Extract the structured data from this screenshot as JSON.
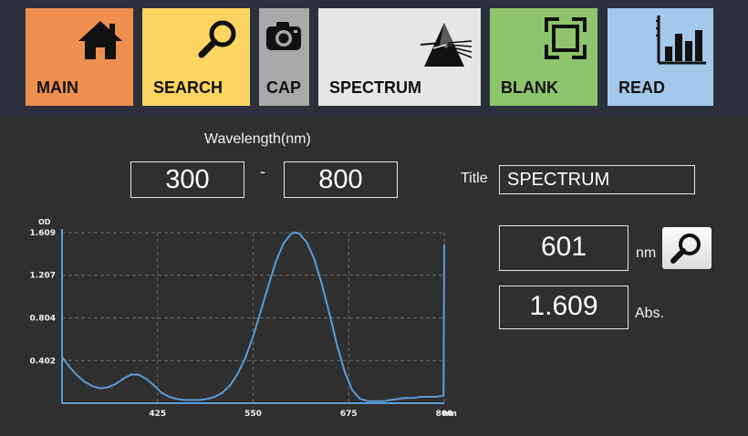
{
  "nav": {
    "main": "MAIN",
    "search": "SEARCH",
    "cap": "CAP",
    "spectrum": "SPECTRUM",
    "blank": "BLANK",
    "read": "READ"
  },
  "colors": {
    "main": "#ee8f4f",
    "search": "#fbd462",
    "cap": "#a9a9a9",
    "spectrum": "#e6e6e6",
    "blank": "#8ec46d",
    "read": "#a4c8ea",
    "curve": "#5b9bd5"
  },
  "wavelength": {
    "heading": "Wavelength(nm)",
    "start": "300",
    "separator": "-",
    "end": "800"
  },
  "title": {
    "label": "Title",
    "value": "SPECTRUM"
  },
  "readout": {
    "wavelength": "601",
    "wavelength_unit": "nm",
    "absorbance": "1.609",
    "absorbance_unit": "Abs."
  },
  "chart_data": {
    "type": "line",
    "title": "",
    "ylabel": "OD",
    "xlabel": "nm",
    "xlim": [
      300,
      800
    ],
    "ylim": [
      0,
      1.609
    ],
    "x_ticks": [
      425,
      550,
      675,
      800
    ],
    "x_tick_labels": [
      "425",
      "550",
      "675",
      "800"
    ],
    "y_ticks": [
      0.402,
      0.804,
      1.207,
      1.609
    ],
    "y_tick_labels": [
      "0.402",
      "0.804",
      "1.207",
      "1.609"
    ],
    "grid": true,
    "series": [
      {
        "x": [
          300,
          310,
          320,
          330,
          340,
          350,
          360,
          370,
          380,
          390,
          400,
          410,
          420,
          430,
          440,
          450,
          460,
          470,
          480,
          490,
          500,
          510,
          520,
          530,
          540,
          550,
          560,
          570,
          580,
          590,
          600,
          605,
          610,
          620,
          630,
          640,
          650,
          660,
          670,
          680,
          690,
          700,
          710,
          720,
          730,
          740,
          750,
          760,
          770,
          780,
          790,
          799,
          800
        ],
        "y": [
          0.44,
          0.34,
          0.26,
          0.2,
          0.16,
          0.14,
          0.15,
          0.18,
          0.23,
          0.27,
          0.27,
          0.23,
          0.17,
          0.1,
          0.06,
          0.04,
          0.03,
          0.03,
          0.03,
          0.04,
          0.06,
          0.1,
          0.17,
          0.28,
          0.43,
          0.63,
          0.87,
          1.11,
          1.34,
          1.51,
          1.6,
          1.61,
          1.6,
          1.52,
          1.36,
          1.12,
          0.84,
          0.54,
          0.29,
          0.12,
          0.04,
          0.02,
          0.02,
          0.02,
          0.03,
          0.04,
          0.05,
          0.05,
          0.06,
          0.06,
          0.06,
          0.07,
          1.5
        ]
      }
    ]
  }
}
